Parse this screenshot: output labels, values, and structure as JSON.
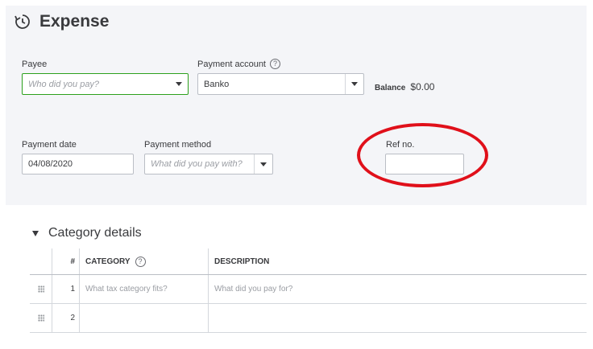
{
  "header": {
    "title": "Expense"
  },
  "form": {
    "payee": {
      "label": "Payee",
      "placeholder": "Who did you pay?"
    },
    "payment_account": {
      "label": "Payment account",
      "help": "?",
      "value": "Banko"
    },
    "balance": {
      "label": "Balance",
      "value": "$0.00"
    },
    "payment_date": {
      "label": "Payment date",
      "value": "04/08/2020"
    },
    "payment_method": {
      "label": "Payment method",
      "placeholder": "What did you pay with?"
    },
    "ref_no": {
      "label": "Ref no.",
      "value": ""
    }
  },
  "category_details": {
    "title": "Category details",
    "columns": {
      "num": "#",
      "category": "CATEGORY",
      "category_help": "?",
      "description": "DESCRIPTION"
    },
    "rows": [
      {
        "num": "1",
        "category_placeholder": "What tax category fits?",
        "description_placeholder": "What did you pay for?"
      },
      {
        "num": "2",
        "category_placeholder": "",
        "description_placeholder": ""
      }
    ]
  },
  "colors": {
    "panel_bg": "#f4f5f8",
    "focus_green": "#2ca01c",
    "annotation_red": "#e0101a"
  }
}
